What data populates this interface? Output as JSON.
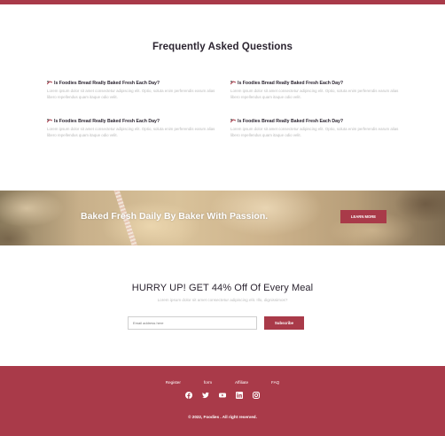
{
  "faq": {
    "title": "Frequently Asked Questions",
    "items": [
      {
        "question": "Is Foodies Bread Really Baked Fresh Each Day?",
        "answer": "Lorem ipsum dolor sit amet consectetur adipiscing elit. Optio, soluta enim perferendis earum alias libero repellendus quam itaque odio velit."
      },
      {
        "question": "Is Foodies Bread Really Baked Fresh Each Day?",
        "answer": "Lorem ipsum dolor sit amet consectetur adipiscing elit. Optio, soluta enim perferendis earum alias libero repellendus quam itaque odio velit."
      },
      {
        "question": "Is Foodies Bread Really Baked Fresh Each Day?",
        "answer": "Lorem ipsum dolor sit amet consectetur adipiscing elit. Optio, soluta enim perferendis earum alias libero repellendus quam itaque odio velit."
      },
      {
        "question": "Is Foodies Bread Really Baked Fresh Each Day?",
        "answer": "Lorem ipsum dolor sit amet consectetur adipiscing elit. Optio, soluta enim perferendis earum alias libero repellendus quam itaque odio velit."
      }
    ]
  },
  "banner": {
    "headline": "Baked Fresh Daily By Baker With Passion.",
    "button_label": "LEARN MORE"
  },
  "promo": {
    "title": "HURRY UP! GET 44% Off Of Every Meal",
    "subtitle": "Lorem ipsum dolor sit amet consectetur adipiscing elit. Illo, dignissimos?",
    "email_placeholder": "Email address here",
    "subscribe_label": "Subscribe"
  },
  "footer": {
    "links": [
      "Register",
      "form",
      "Affiliate",
      "FAQ"
    ],
    "social_icons": [
      "facebook-icon",
      "twitter-icon",
      "youtube-icon",
      "linkedin-icon",
      "instagram-icon"
    ],
    "copyright": "© 2022, Foodies . All right reserved."
  },
  "colors": {
    "brand": "#a93a49",
    "heading": "#2b2430",
    "muted_text": "#b9b9b9"
  }
}
